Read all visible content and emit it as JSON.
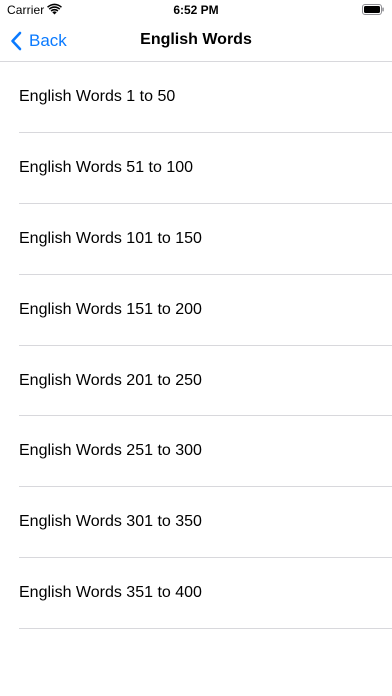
{
  "status_bar": {
    "carrier": "Carrier",
    "time": "6:52 PM",
    "wifi_icon": "wifi-icon",
    "battery_icon": "battery-icon"
  },
  "nav": {
    "back_label": "Back",
    "back_icon": "chevron-left-icon",
    "title": "English Words"
  },
  "colors": {
    "accent": "#0a7aff",
    "divider": "#d8d8dc",
    "text": "#000000",
    "background": "#ffffff"
  },
  "list": {
    "items": [
      {
        "label": "English Words 1 to 50"
      },
      {
        "label": "English Words 51 to 100"
      },
      {
        "label": "English Words 101 to 150"
      },
      {
        "label": "English Words 151 to 200"
      },
      {
        "label": "English Words 201 to 250"
      },
      {
        "label": "English Words 251 to 300"
      },
      {
        "label": "English Words 301 to 350"
      },
      {
        "label": "English Words 351 to 400"
      }
    ]
  }
}
